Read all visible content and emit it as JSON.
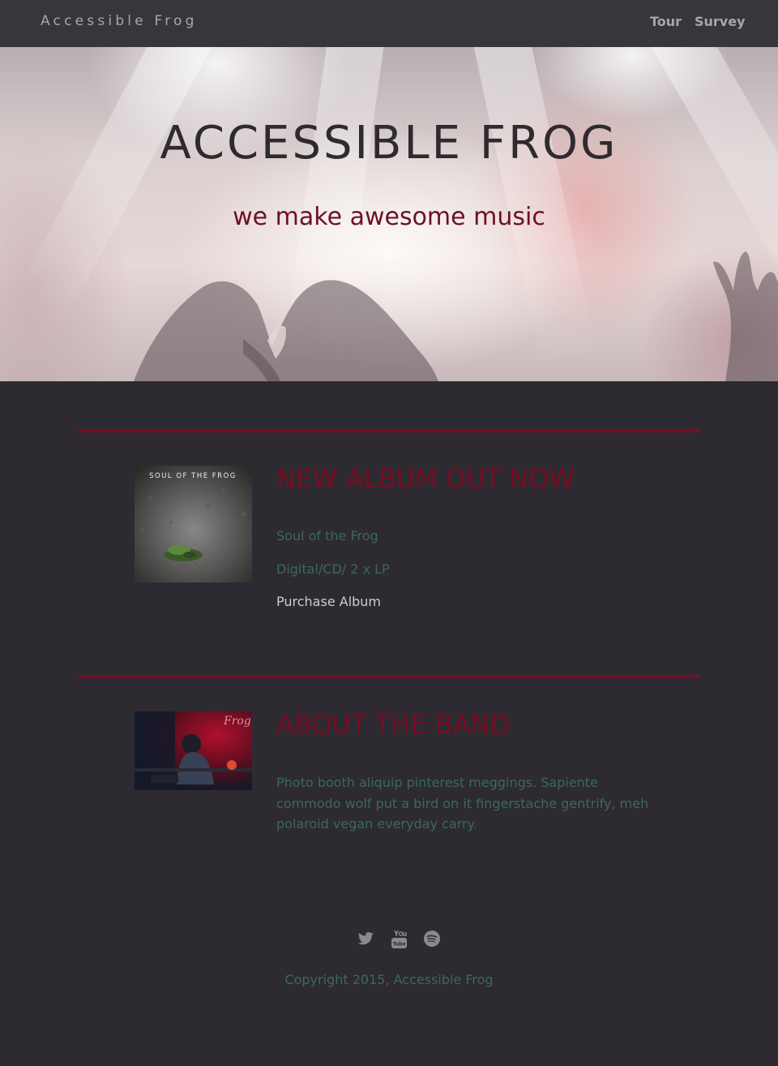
{
  "nav": {
    "brand": "Accessible Frog",
    "links": [
      {
        "label": "Tour"
      },
      {
        "label": "Survey"
      }
    ]
  },
  "hero": {
    "title": "ACCESSIBLE FROG",
    "subtitle": "we make awesome music"
  },
  "album": {
    "heading": "NEW ALBUM OUT NOW",
    "cover_text": "SOUL OF THE FROG",
    "name": "Soul of the Frog",
    "formats": "Digital/CD/ 2 x LP",
    "purchase_label": "Purchase Album"
  },
  "about": {
    "heading": "ABOUT THE BAND",
    "photo_text": "Frog",
    "body": "Photo booth aliquip pinterest meggings. Sapiente commodo wolf put a bird on it fingerstache gentrify, meh polaroid vegan everyday carry."
  },
  "footer": {
    "social_icons": [
      "twitter-icon",
      "youtube-icon",
      "spotify-icon"
    ],
    "copyright": "Copyright 2015, Accessible Frog"
  },
  "colors": {
    "page_bg": "#2d2a31",
    "nav_bg": "#38353b",
    "accent": "#770c21",
    "green_text": "#3c6a54"
  }
}
